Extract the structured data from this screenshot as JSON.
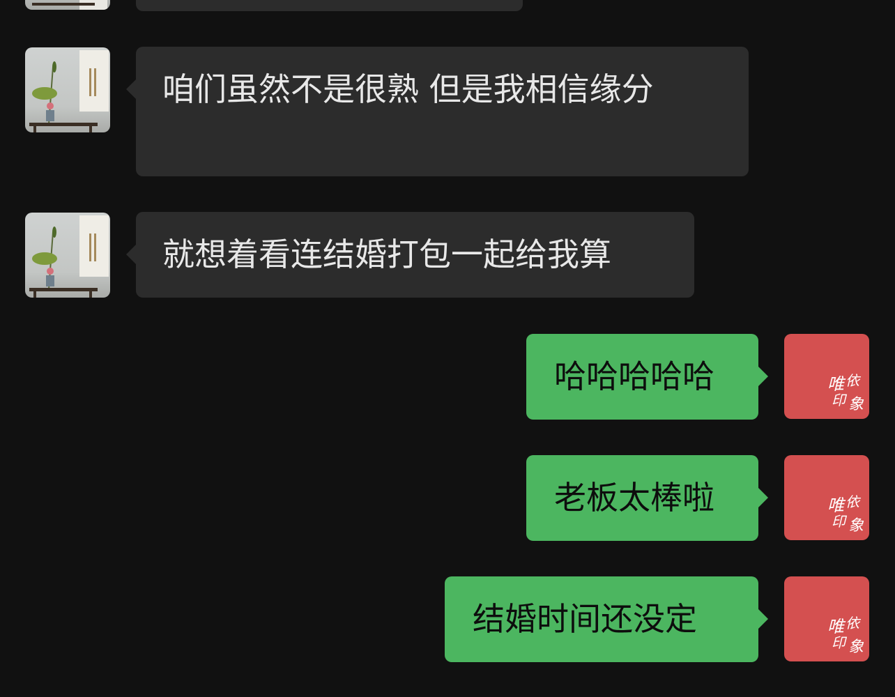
{
  "colors": {
    "background": "#111111",
    "incoming_bubble": "#2c2c2c",
    "outgoing_bubble": "#4cb660",
    "outgoing_avatar": "#d45050"
  },
  "incoming_messages": [
    {
      "text": "咱们虽然不是很熟 但是我相信缘分"
    },
    {
      "text": "就想着看连结婚打包一起给我算"
    }
  ],
  "outgoing_messages": [
    {
      "text": "哈哈哈哈哈"
    },
    {
      "text": "老板太棒啦"
    },
    {
      "text": "结婚时间还没定"
    }
  ],
  "avatars": {
    "contact_icon": "ikebana-painting-avatar",
    "self_icon": "red-seal-avatar",
    "self_seal_text": "唯依 印象"
  }
}
